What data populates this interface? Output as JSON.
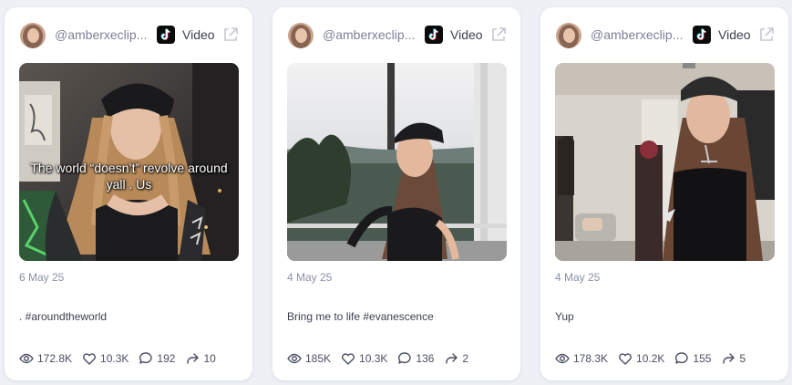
{
  "posts": [
    {
      "handle": "@amberxeclip...",
      "platform_label": "Video",
      "date": "6 May 25",
      "caption": ". #aroundtheworld",
      "overlay_text": "The world “doesn’t” revolve around yall . Us",
      "stats": {
        "views": "172.8K",
        "likes": "10.3K",
        "comments": "192",
        "shares": "10"
      }
    },
    {
      "handle": "@amberxeclip...",
      "platform_label": "Video",
      "date": "4 May 25",
      "caption": "Bring me to life #evanescence",
      "stats": {
        "views": "185K",
        "likes": "10.3K",
        "comments": "136",
        "shares": "2"
      }
    },
    {
      "handle": "@amberxeclip...",
      "platform_label": "Video",
      "date": "4 May 25",
      "caption": "Yup",
      "stats": {
        "views": "178.3K",
        "likes": "10.2K",
        "comments": "155",
        "shares": "5"
      }
    }
  ],
  "icons": {
    "platform": "tiktok-icon",
    "external": "external-link-icon",
    "views": "eye-icon",
    "likes": "heart-icon",
    "comments": "comment-icon",
    "shares": "share-icon"
  }
}
